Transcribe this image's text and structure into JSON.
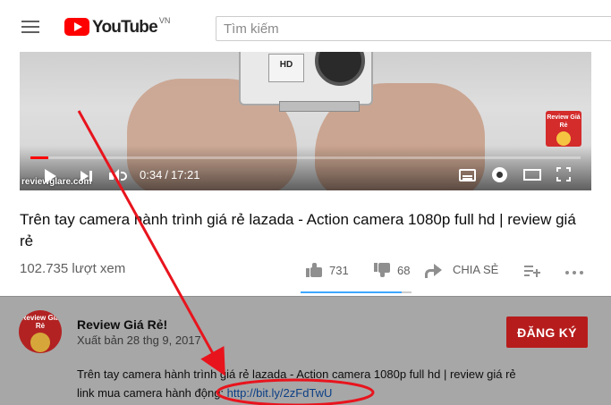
{
  "header": {
    "logo_text": "YouTube",
    "country_code": "VN",
    "search_placeholder": "Tìm kiếm"
  },
  "player": {
    "overlay_badge_text": "Review Giá Rẻ",
    "watermark": "reviewglare.com",
    "current_time": "0:34",
    "time_separator": "/",
    "duration": "17:21",
    "progress_fraction": 0.033
  },
  "video": {
    "title": "Trên tay camera hành trình giá rẻ lazada - Action camera 1080p full hd | review giá rẻ",
    "views": "102.735 lượt xem",
    "likes": "731",
    "dislikes": "68",
    "share_label": "CHIA SẺ",
    "like_ratio": 0.915
  },
  "channel": {
    "avatar_text": "Review Giá Rẻ",
    "name": "Review Giá Rẻ!",
    "publish_date": "Xuất bản 28 thg 9, 2017",
    "subscribe_label": "ĐĂNG KÝ"
  },
  "description": {
    "line1": "Trên tay camera hành trình giá rẻ lazada - Action camera 1080p full hd | review giá rẻ",
    "line2_prefix": "link mua camera hành động: ",
    "link_text": "http://bit.ly/2zFdTwU"
  },
  "colors": {
    "brand_red": "#ff0000",
    "subscribe_red": "#b71c1c",
    "annotation_red": "#e8141d",
    "link_blue": "#0b3f86",
    "sentiment_blue": "#3ea6ff"
  }
}
